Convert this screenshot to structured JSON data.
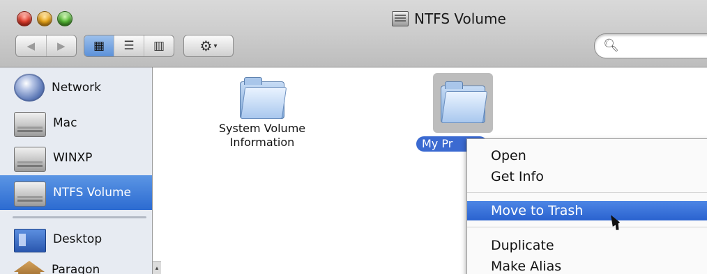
{
  "window": {
    "title": "NTFS Volume"
  },
  "toolbar": {
    "nav": {
      "back": "◀",
      "forward": "▶"
    },
    "view": [
      {
        "name": "icon-view",
        "glyph": "▦"
      },
      {
        "name": "list-view",
        "glyph": "☰"
      },
      {
        "name": "column-view",
        "glyph": "▥"
      }
    ],
    "action": {
      "glyph": "⚙",
      "caret": "▾"
    },
    "search": {
      "value": "",
      "placeholder": ""
    }
  },
  "sidebar": {
    "items": [
      {
        "label": "Network",
        "icon": "network-globe-icon",
        "selected": false
      },
      {
        "label": "Mac",
        "icon": "hard-disk-icon",
        "selected": false
      },
      {
        "label": "WINXP",
        "icon": "hard-disk-icon",
        "selected": false
      },
      {
        "label": "NTFS Volume",
        "icon": "hard-disk-icon",
        "selected": true
      },
      {
        "label": "Desktop",
        "icon": "desktop-icon",
        "selected": false
      },
      {
        "label": "Paragon",
        "icon": "home-icon",
        "selected": false
      }
    ]
  },
  "main": {
    "files": [
      {
        "label": "System Volume\nInformation",
        "selected": false
      },
      {
        "label": "My Pr",
        "selected": true
      }
    ]
  },
  "context_menu": {
    "items": [
      {
        "label": "Open",
        "selected": false
      },
      {
        "label": "Get Info",
        "selected": false
      },
      {
        "label": "Move to Trash",
        "selected": true
      },
      {
        "label": "Duplicate",
        "selected": false
      },
      {
        "label": "Make Alias",
        "selected": false
      }
    ]
  }
}
